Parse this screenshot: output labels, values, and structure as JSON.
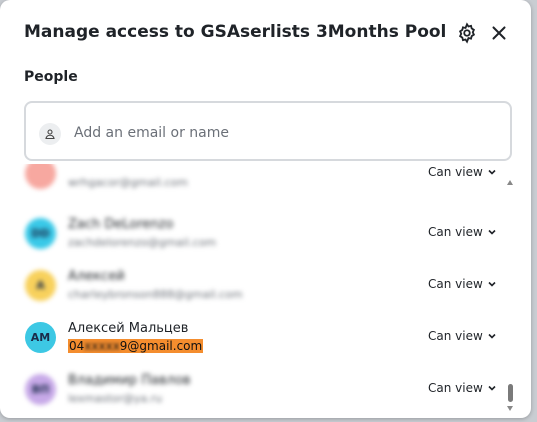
{
  "dialog": {
    "title": "Manage access to GSAserlists 3Months Pool",
    "settings_icon": "gear-icon",
    "close_icon": "close-icon"
  },
  "people": {
    "label": "People",
    "search_placeholder": "Add an email or name",
    "search_icon": "person-icon"
  },
  "members": [
    {
      "initials": "",
      "name": "",
      "email": "wrhgacor@gmail.com",
      "role": "Can view",
      "avatar_color": "#f7a8a0",
      "blurred": true
    },
    {
      "initials": "DD",
      "name": "Zach DeLorenzo",
      "email": "zachdelorenzo@gmail.com",
      "role": "Can view",
      "avatar_color": "#39c9e8",
      "blurred": true
    },
    {
      "initials": "A",
      "name": "Алексей",
      "email": "charleybronson888@gmail.com",
      "role": "Can view",
      "avatar_color": "#f8d15c",
      "blurred": true
    },
    {
      "initials": "AM",
      "name": "Алексей Мальцев",
      "email_prefix": "04",
      "email_masked": "xxxxx",
      "email_suffix": "9@gmail.com",
      "role": "Can view",
      "avatar_color": "#3dc8e4",
      "blurred": false
    },
    {
      "initials": "ВП",
      "name": "Владимир Павлов",
      "email": "lexmastor@ya.ru",
      "role": "Can view",
      "avatar_color": "#c7a9e8",
      "blurred": true
    }
  ],
  "colors": {
    "highlight": "#f48d2e",
    "border": "#d6d9dd"
  }
}
